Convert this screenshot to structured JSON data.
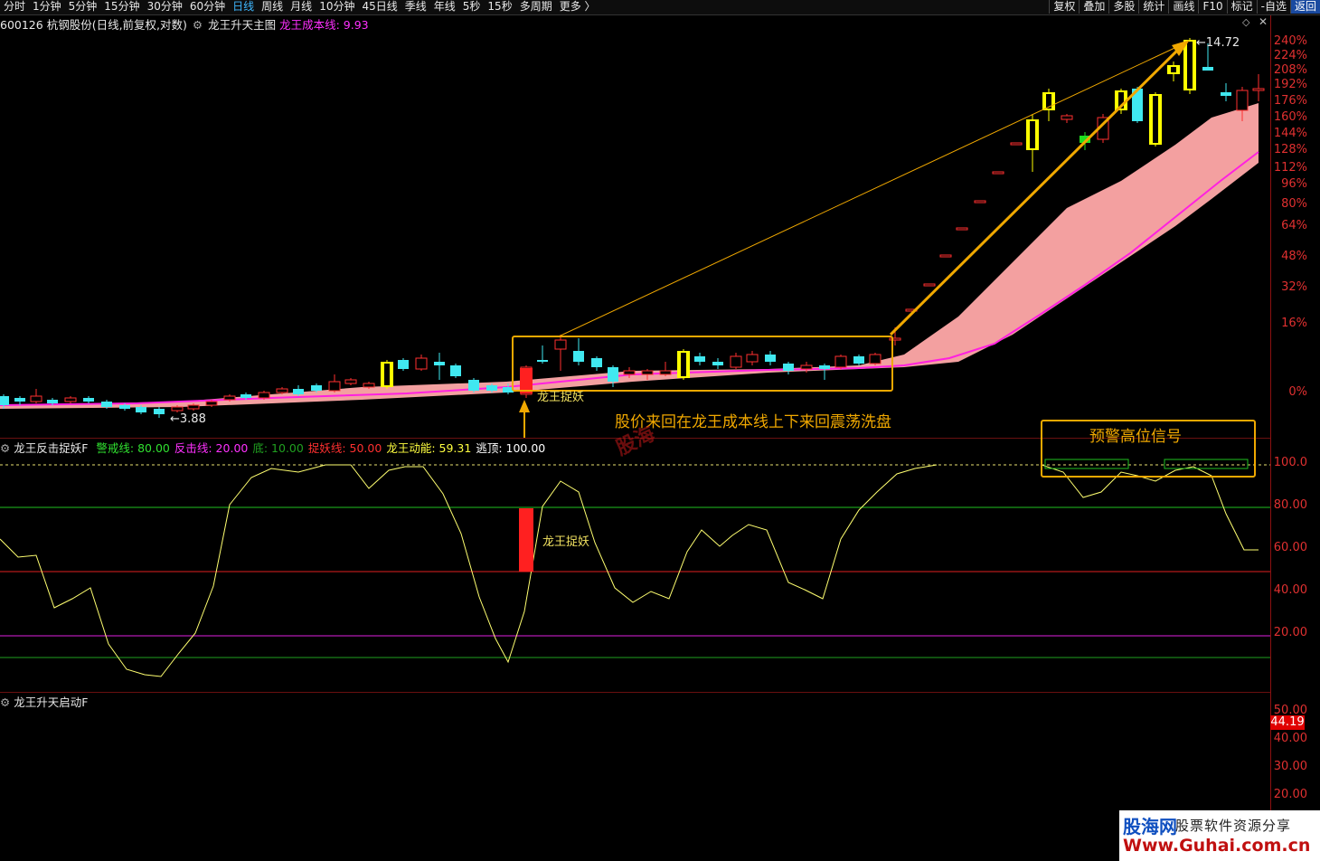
{
  "toolbar": {
    "periods": [
      "分时",
      "1分钟",
      "5分钟",
      "15分钟",
      "30分钟",
      "60分钟",
      "日线",
      "周线",
      "月线",
      "10分钟",
      "45日线",
      "季线",
      "年线",
      "5秒",
      "15秒",
      "多周期",
      "更多 〉"
    ],
    "active_period": "日线",
    "right_items": [
      "复权",
      "叠加",
      "多股",
      "统计",
      "画线",
      "F10",
      "标记",
      "-自选",
      "返回"
    ]
  },
  "main_header": {
    "stock": "600126 杭钢股份(日线,前复权,对数)",
    "indicator_name": "龙王升天主图",
    "cost_label": "龙王成本线:",
    "cost_value": "9.93"
  },
  "main_axis": [
    "240%",
    "224%",
    "208%",
    "192%",
    "176%",
    "160%",
    "144%",
    "128%",
    "112%",
    "96%",
    "80%",
    "64%",
    "48%",
    "32%",
    "16%",
    "0%"
  ],
  "main_annotations": {
    "low_price": "3.88",
    "high_price": "14.72",
    "signal_label_main": "龙王捉妖",
    "washout_text": "股价来回在龙王成本线上下来回震荡洗盘",
    "watermark": "股海"
  },
  "sub1_header": {
    "name": "龙王反击捉妖F",
    "items": [
      {
        "label": "警戒线:",
        "value": "80.00",
        "color": "#30e030"
      },
      {
        "label": "反击线:",
        "value": "20.00",
        "color": "#ff30ff"
      },
      {
        "label": "底:",
        "value": "10.00",
        "color": "#20a020"
      },
      {
        "label": "捉妖线:",
        "value": "50.00",
        "color": "#ff3030"
      },
      {
        "label": "龙王动能:",
        "value": "59.31",
        "color": "#ffff40"
      },
      {
        "label": "逃顶:",
        "value": "100.00",
        "color": "#ffffff"
      }
    ]
  },
  "sub1_axis": [
    "100.0",
    "80.00",
    "60.00",
    "40.00",
    "20.00"
  ],
  "sub1_annotations": {
    "signal_label": "龙王捉妖",
    "warning_text": "预警高位信号"
  },
  "sub2_header": {
    "name": "龙王升天启动F"
  },
  "sub2_axis": [
    "50.00",
    "40.00",
    "30.00",
    "20.00"
  ],
  "sub2_badge": "44.19",
  "logo": {
    "name": "股海网",
    "tagline": "股票软件资源分享",
    "url": "Www.Guhai.com.cn"
  },
  "colors": {
    "up": "#ff3030",
    "down": "#40e8f0",
    "yellow_bar": "#ffff00",
    "cost_line": "#ff20e0",
    "band": "#f3a0a0",
    "annotation": "#f0a800",
    "axis_text": "#e03030"
  }
}
